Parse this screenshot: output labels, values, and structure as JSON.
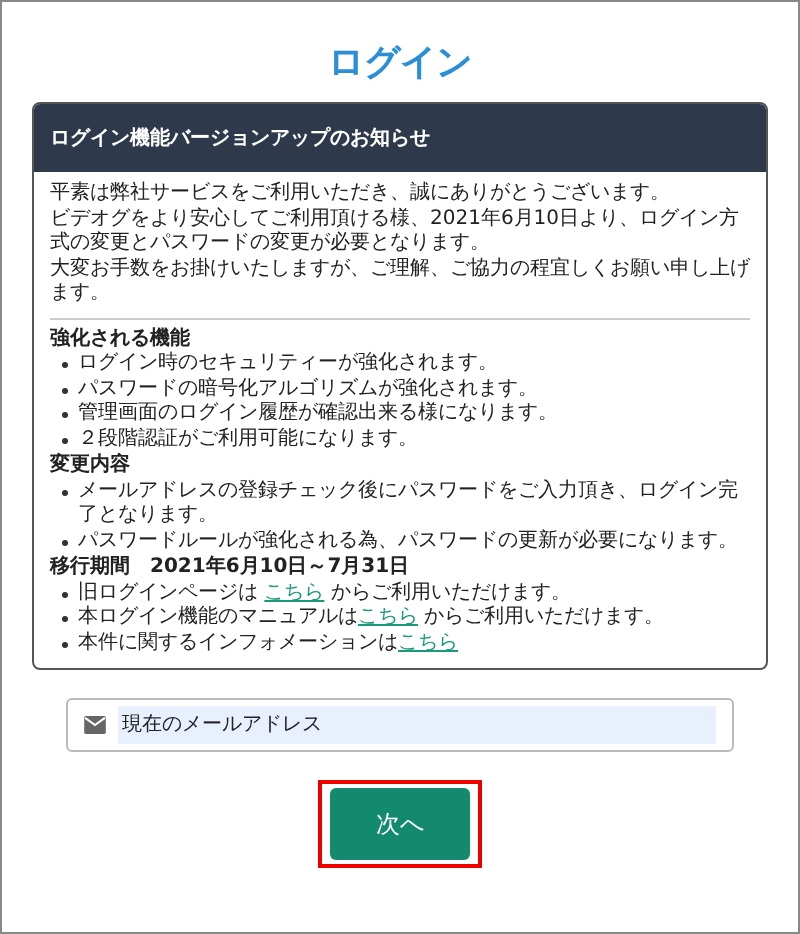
{
  "title": "ログイン",
  "notice": {
    "heading": "ログイン機能バージョンアップのお知らせ",
    "intro": [
      "平素は弊社サービスをご利用いただき、誠にありがとうございます。",
      "ビデオグをより安心してご利用頂ける様、2021年6月10日より、ログイン方式の変更とパスワードの変更が必要となります。",
      "大変お手数をお掛けいたしますが、ご理解、ご協力の程宜しくお願い申し上げます。"
    ],
    "sections": [
      {
        "heading": "強化される機能",
        "items": [
          {
            "text": "ログイン時のセキュリティーが強化されます。"
          },
          {
            "text": "パスワードの暗号化アルゴリズムが強化されます。"
          },
          {
            "text": "管理画面のログイン履歴が確認出来る様になります。"
          },
          {
            "text": "２段階認証がご利用可能になります。"
          }
        ]
      },
      {
        "heading": "変更内容",
        "items": [
          {
            "text": "メールアドレスの登録チェック後にパスワードをご入力頂き、ログイン完了となります。"
          },
          {
            "text": "パスワードルールが強化される為、パスワードの更新が必要になります。"
          }
        ]
      },
      {
        "heading": "移行期間　2021年6月10日～7月31日",
        "items": [
          {
            "text": "旧ログインページは ",
            "link": "こちら",
            "after": " からご利用いただけます。"
          },
          {
            "text": "本ログイン機能のマニュアルは",
            "link": "こちら",
            "after": " からご利用いただけます。"
          },
          {
            "text": "本件に関するインフォメーションは",
            "link": "こちら"
          }
        ]
      }
    ]
  },
  "email_field": {
    "placeholder": "現在のメールアドレス"
  },
  "next_button": {
    "label": "次へ",
    "highlighted": true
  }
}
